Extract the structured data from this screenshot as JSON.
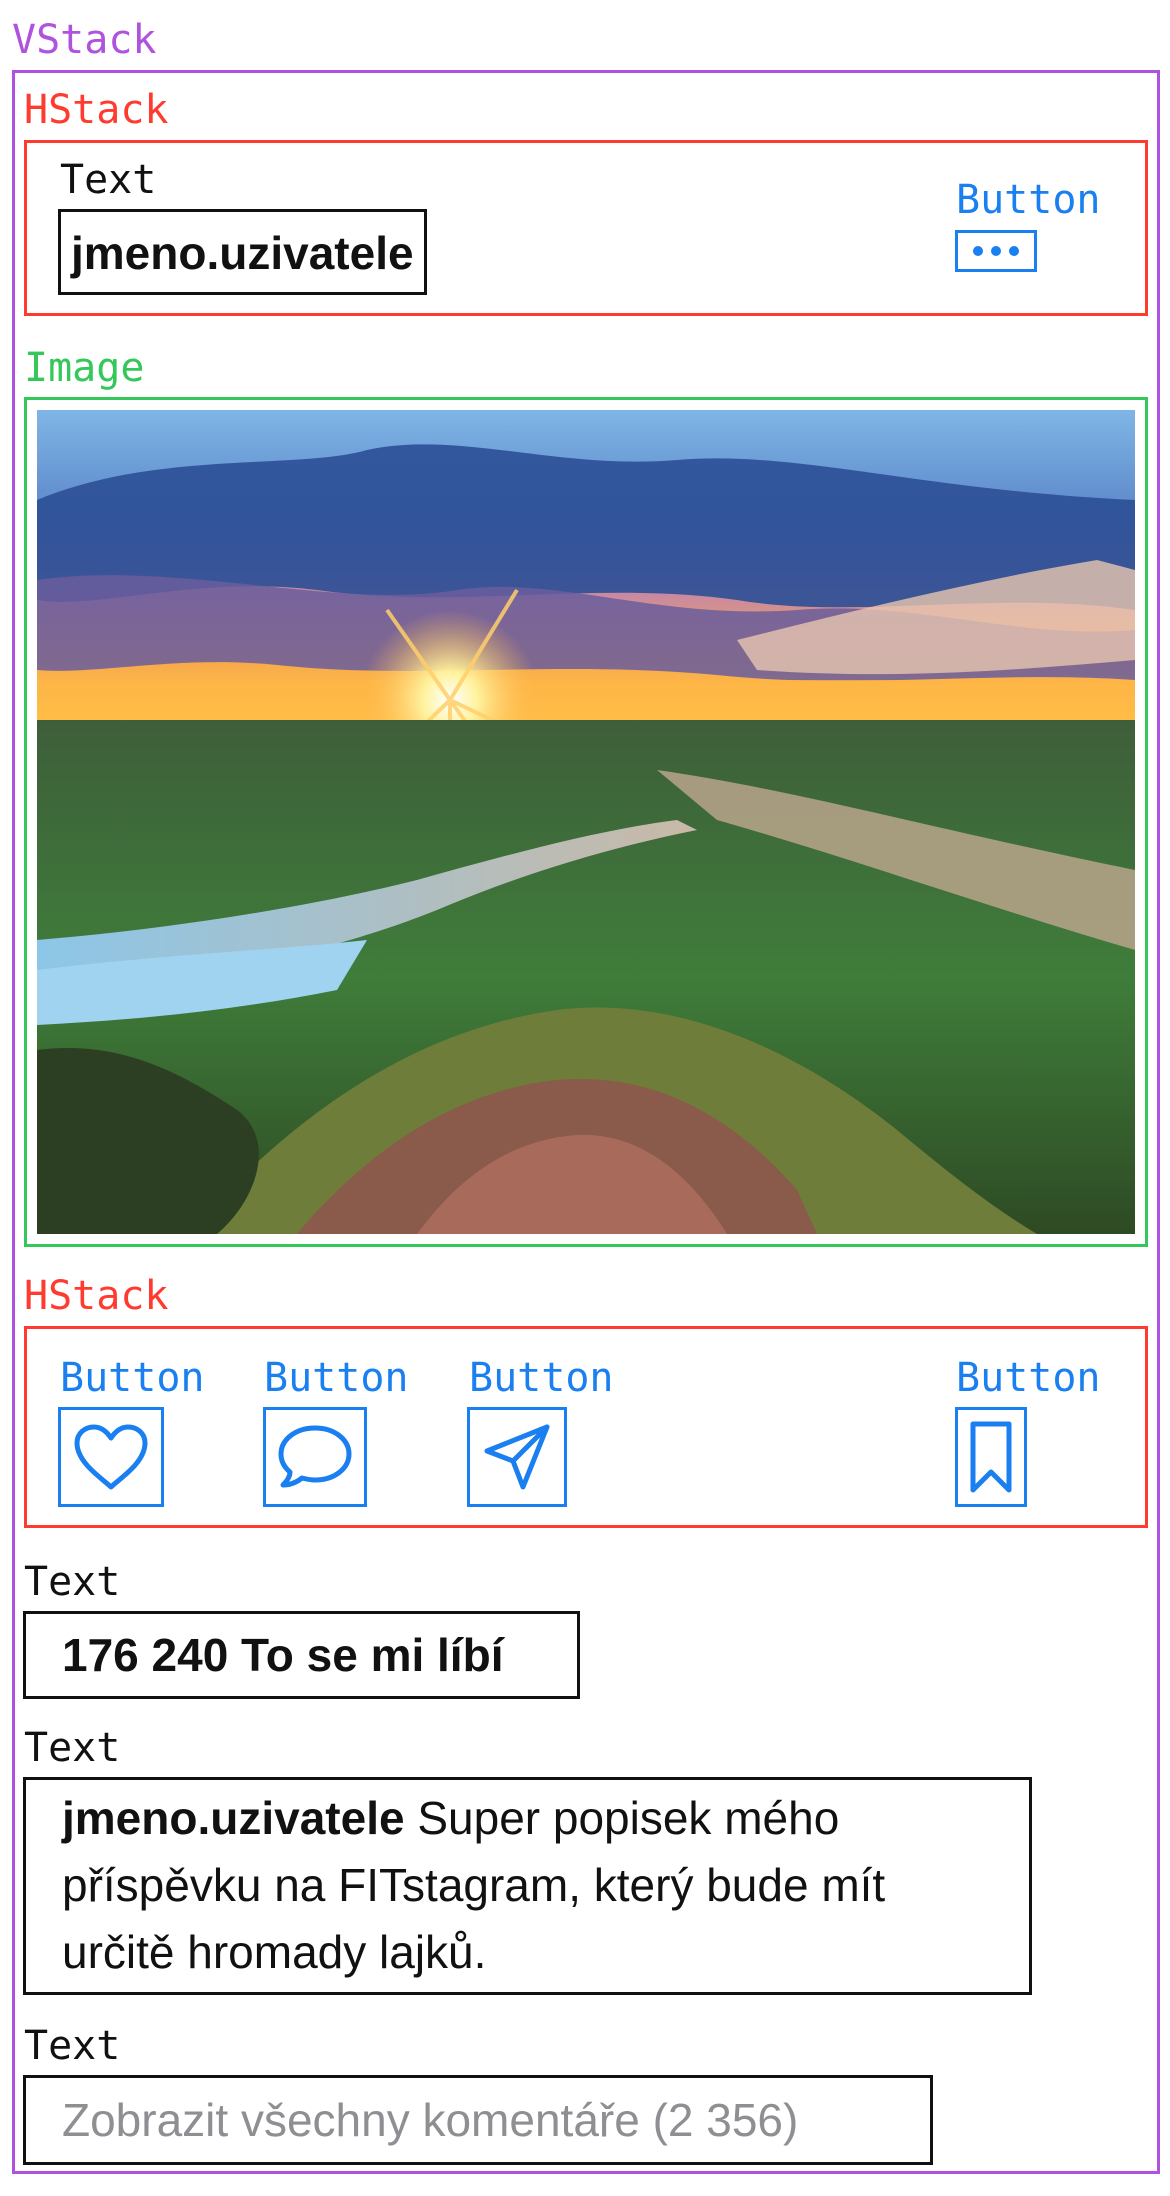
{
  "labels": {
    "vstack": "VStack",
    "hstack_top": "HStack",
    "text_username": "Text",
    "button_more": "Button",
    "image": "Image",
    "hstack_actions": "HStack",
    "button_like": "Button",
    "button_comment": "Button",
    "button_share": "Button",
    "button_bookmark": "Button",
    "text_likes": "Text",
    "text_caption": "Text",
    "text_comments": "Text"
  },
  "post": {
    "username": "jmeno.uzivatele",
    "likes": "176 240 To se mi líbí",
    "caption_username": "jmeno.uzivatele",
    "caption_line1": " Super popisek mého",
    "caption_line2": "příspěvku na FITstagram, který bude mít",
    "caption_line3": "určitě hromady lajků.",
    "comments_link": "Zobrazit všechny komentáře (2 356)"
  },
  "icons": {
    "more": "ellipsis-icon",
    "like": "heart-icon",
    "comment": "speech-bubble-icon",
    "share": "paper-plane-icon",
    "bookmark": "bookmark-icon"
  },
  "colors": {
    "vstack": "#af52de",
    "hstack": "#ff3b30",
    "image": "#34c759",
    "button": "#1a7ff0",
    "text": "#111111",
    "secondary_text": "#8e8e93"
  }
}
